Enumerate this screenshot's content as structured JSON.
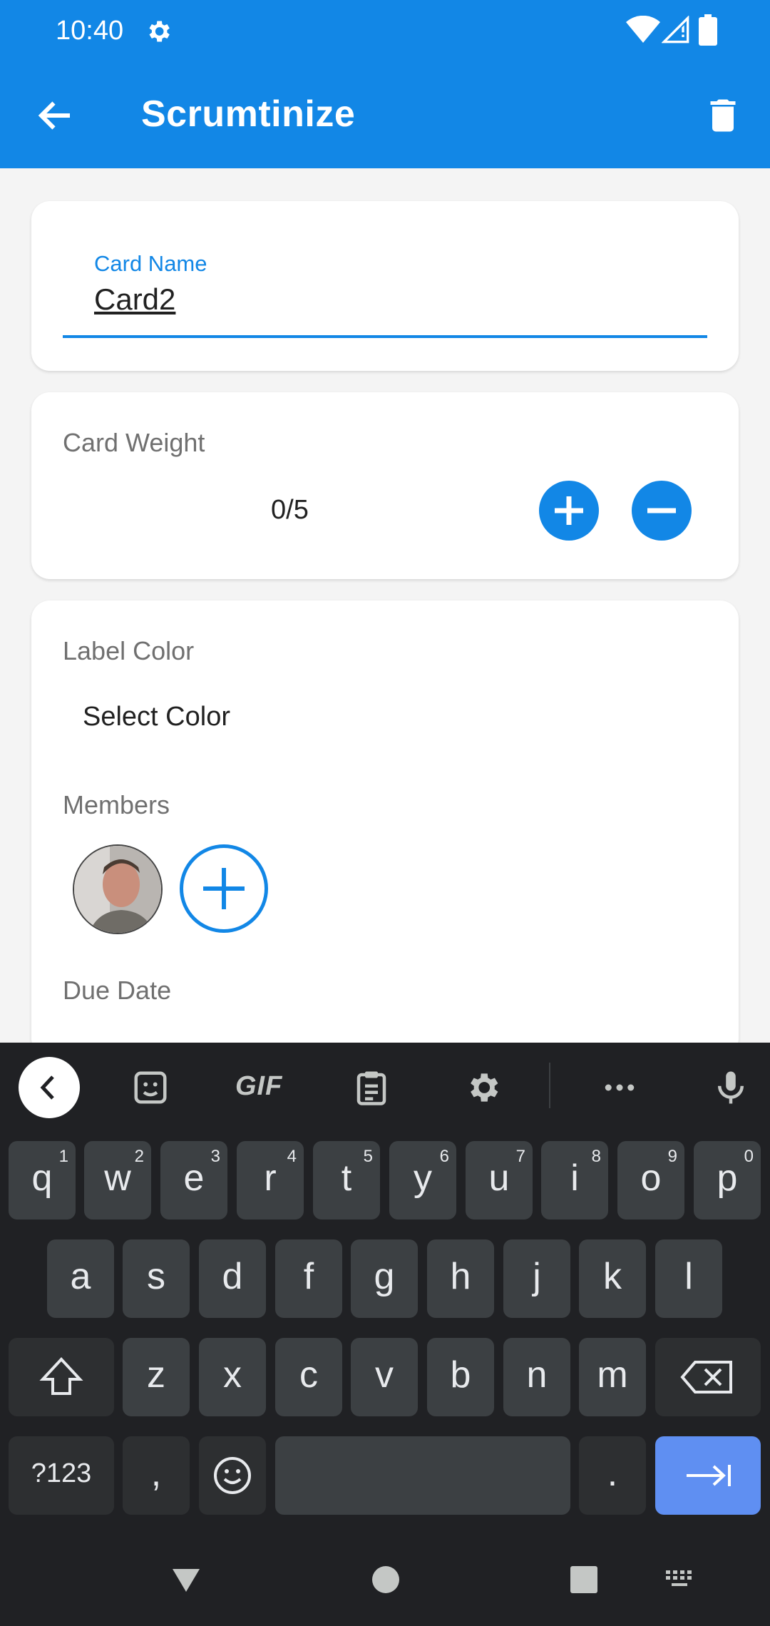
{
  "status_bar": {
    "time": "10:40"
  },
  "app_bar": {
    "title": "Scrumtinize"
  },
  "card_name": {
    "label": "Card Name",
    "value": "Card2"
  },
  "card_weight": {
    "label": "Card Weight",
    "value": "0/5"
  },
  "label_color": {
    "label": "Label Color",
    "select_text": "Select Color"
  },
  "members": {
    "label": "Members"
  },
  "due_date": {
    "label": "Due Date"
  },
  "keyboard": {
    "toolbar_gif": "GIF",
    "row1": [
      {
        "key": "q",
        "hint": "1"
      },
      {
        "key": "w",
        "hint": "2"
      },
      {
        "key": "e",
        "hint": "3"
      },
      {
        "key": "r",
        "hint": "4"
      },
      {
        "key": "t",
        "hint": "5"
      },
      {
        "key": "y",
        "hint": "6"
      },
      {
        "key": "u",
        "hint": "7"
      },
      {
        "key": "i",
        "hint": "8"
      },
      {
        "key": "o",
        "hint": "9"
      },
      {
        "key": "p",
        "hint": "0"
      }
    ],
    "row2": [
      "a",
      "s",
      "d",
      "f",
      "g",
      "h",
      "j",
      "k",
      "l"
    ],
    "row3": [
      "z",
      "x",
      "c",
      "v",
      "b",
      "n",
      "m"
    ],
    "symbols_key": "?123",
    "comma_key": ",",
    "period_key": "."
  },
  "colors": {
    "primary": "#1287e6",
    "keyboard_bg": "#202124",
    "key_bg": "#3c4043",
    "enter_key": "#5f8ff2"
  }
}
